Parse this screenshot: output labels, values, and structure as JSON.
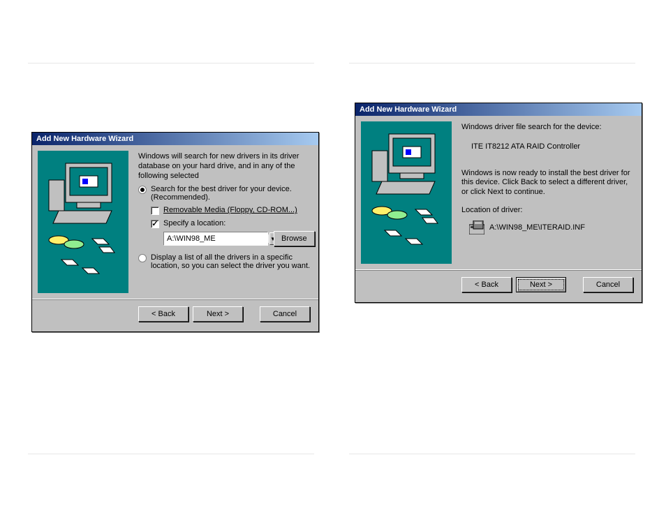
{
  "dialog1": {
    "title": "Add New Hardware Wizard",
    "intro": "Windows will search for new drivers in its driver database on your hard drive, and in any of the following selected",
    "option_best_label": "Search for the best driver for your device. (Recommended).",
    "check_removable_label": "Removable Media (Floppy, CD-ROM...)",
    "check_specify_label": "Specify a location:",
    "location_value": "A:\\WIN98_ME",
    "browse_label": "Browse",
    "option_list_label": "Display a list of all the drivers in a specific location, so you can select the driver you want.",
    "back_label": "< Back",
    "next_label": "Next >",
    "cancel_label": "Cancel"
  },
  "dialog2": {
    "title": "Add New Hardware Wizard",
    "heading": "Windows driver file search for the device:",
    "device_name": "ITE IT8212 ATA RAID Controller",
    "ready_text": "Windows is now ready to install the best driver for this device. Click Back to select a different driver, or click Next to continue.",
    "location_label": "Location of driver:",
    "driver_path": "A:\\WIN98_ME\\ITERAID.INF",
    "back_label": "< Back",
    "next_label": "Next >",
    "cancel_label": "Cancel"
  }
}
